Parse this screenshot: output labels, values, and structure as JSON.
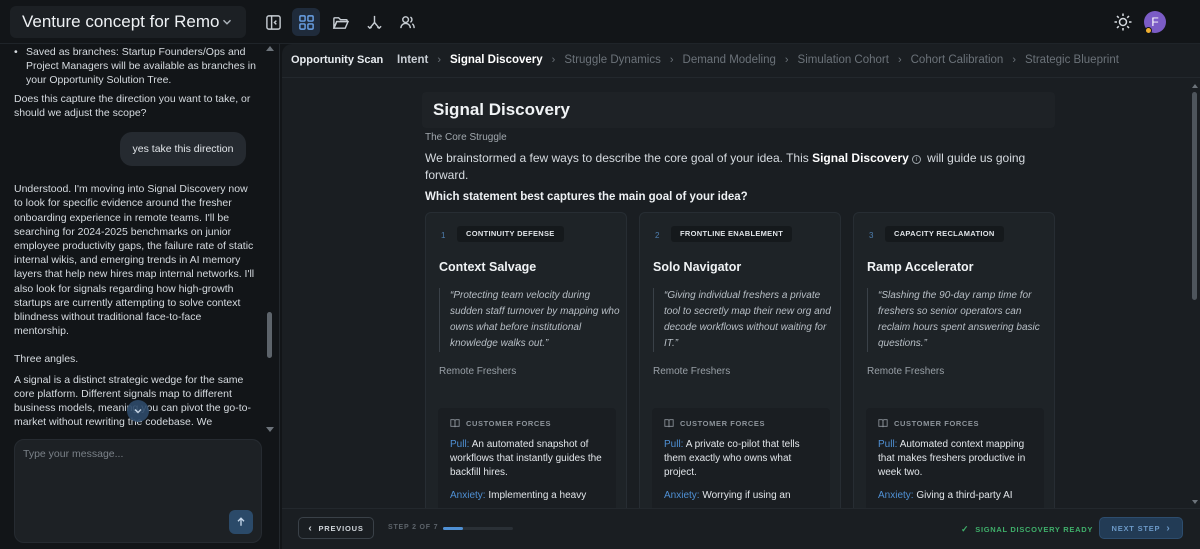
{
  "header": {
    "project_title": "Venture concept for Remo...",
    "user_initial": "F"
  },
  "toolbar_icons": [
    "sidebar-toggle-icon",
    "grid-icon",
    "folder-icon",
    "branch-icon",
    "users-icon",
    "sun-icon"
  ],
  "chat": {
    "bullet_saved_branches": "Saved as branches: Startup Founders/Ops and Project Managers will be available as branches in your Opportunity Solution Tree.",
    "question": "Does this capture the direction you want to take, or should we adjust the scope?",
    "user_message": "yes take this direction",
    "assistant_msg_1": "Understood. I'm moving into Signal Discovery now to look for specific evidence around the fresher onboarding experience in remote teams. I'll be searching for 2024-2025 benchmarks on junior employee productivity gaps, the failure rate of static internal wikis, and emerging trends in AI memory layers that help new hires map internal networks. I'll also look for signals regarding how high-growth startups are currently attempting to solve context blindness without traditional face-to-face mentorship.",
    "assistant_msg_2": "Three angles.",
    "assistant_msg_3": "A signal is a distinct strategic wedge for the same core platform. Different signals map to different business models, meaning you can pivot the go-to-market without rewriting the codebase. We",
    "input_placeholder": "Type your message..."
  },
  "stepbar": {
    "section": "Opportunity Scan",
    "steps": [
      {
        "label": "Intent",
        "state": "done"
      },
      {
        "label": "Signal Discovery",
        "state": "current"
      },
      {
        "label": "Struggle Dynamics",
        "state": "upcoming"
      },
      {
        "label": "Demand Modeling",
        "state": "upcoming"
      },
      {
        "label": "Simulation Cohort",
        "state": "upcoming"
      },
      {
        "label": "Cohort Calibration",
        "state": "upcoming"
      },
      {
        "label": "Strategic Blueprint",
        "state": "upcoming"
      }
    ]
  },
  "main": {
    "title": "Signal Discovery",
    "subtitle": "The Core Struggle",
    "desc_before": "We brainstormed a few ways to describe the core goal of your idea. This ",
    "desc_bold": "Signal Discovery",
    "desc_after": " will guide us going forward.",
    "question": "Which statement best captures the main goal of your idea?",
    "cards": [
      {
        "num": "1",
        "tag": "CONTINUITY DEFENSE",
        "title": "Context Salvage",
        "quote": "“Protecting team velocity during sudden staff turnover by mapping who owns what before institutional knowledge walks out.”",
        "audience": "Remote Freshers",
        "forces_label": "CUSTOMER FORCES",
        "pull_label": "Pull:",
        "pull": "An automated snapshot of workflows that instantly guides the backfill hires.",
        "anxiety_label": "Anxiety:",
        "anxiety": "Implementing a heavy"
      },
      {
        "num": "2",
        "tag": "FRONTLINE ENABLEMENT",
        "title": "Solo Navigator",
        "quote": "“Giving individual freshers a private tool to secretly map their new org and decode workflows without waiting for IT.”",
        "audience": "Remote Freshers",
        "forces_label": "CUSTOMER FORCES",
        "pull_label": "Pull:",
        "pull": "A private co-pilot that tells them exactly who owns what project.",
        "anxiety_label": "Anxiety:",
        "anxiety": "Worrying if using an"
      },
      {
        "num": "3",
        "tag": "CAPACITY RECLAMATION",
        "title": "Ramp Accelerator",
        "quote": "“Slashing the 90-day ramp time for freshers so senior operators can reclaim hours spent answering basic questions.”",
        "audience": "Remote Freshers",
        "forces_label": "CUSTOMER FORCES",
        "pull_label": "Pull:",
        "pull": "Automated context mapping that makes freshers productive in week two.",
        "anxiety_label": "Anxiety:",
        "anxiety": "Giving a third-party AI"
      }
    ]
  },
  "footer": {
    "previous_label": "PREVIOUS",
    "step_count": "STEP 2 OF 7",
    "progress": 0.2857,
    "ready_label": "SIGNAL DISCOVERY READY",
    "next_label": "NEXT STEP"
  },
  "colors": {
    "accent": "#4f90d4",
    "ready": "#3fae6a",
    "avatar": "#7b5cc6"
  }
}
